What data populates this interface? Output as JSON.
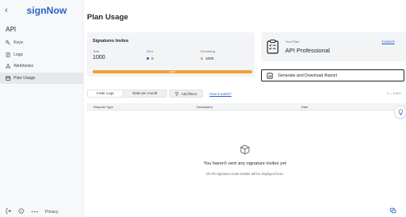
{
  "sidebar": {
    "back_icon": "‹",
    "logo": "signNow",
    "section": "API",
    "items": [
      {
        "label": "Keys",
        "icon": "key-icon",
        "active": false
      },
      {
        "label": "Logs",
        "icon": "logs-icon",
        "active": false
      },
      {
        "label": "Webhooks",
        "icon": "webhooks-icon",
        "active": false
      },
      {
        "label": "Plan Usage",
        "icon": "plan-usage-icon",
        "active": true
      }
    ],
    "footer": {
      "privacy": "Privacy"
    }
  },
  "main": {
    "title": "Plan Usage",
    "invites_card": {
      "title": "Signatures Invites",
      "total_label": "Total",
      "total_value": "1000",
      "sent_label": "Sent",
      "sent_value": "0",
      "remaining_label": "Remaining",
      "remaining_value": "1000",
      "progress_label": "100%",
      "progress_fraction": 1.0,
      "sent_color": "#2a63c9",
      "remaining_color": "#f0a13c"
    },
    "plan_card": {
      "label": "Your Plan",
      "name": "API Professional",
      "invoices": "Invoices"
    },
    "report_button": "Generate and Download Report",
    "tabs": [
      {
        "label": "Invite Logs",
        "active": true
      },
      {
        "label": "Stats per month",
        "active": false
      }
    ],
    "add_filters": "Add filters",
    "how_it_works": "How it works?",
    "pager": "1 — 0 of 0",
    "table": {
      "columns": [
        "Request Type",
        "Description",
        "Date"
      ]
    },
    "empty": {
      "title": "You haven't sent any signature invites yet",
      "subtitle": "All API signature invite details will be displayed here."
    }
  },
  "colors": {
    "brand": "#2a63c9",
    "progress": "#f0a13c",
    "sidebar_bg": "#f7f8f9",
    "card_bg": "#f2f4f6"
  }
}
